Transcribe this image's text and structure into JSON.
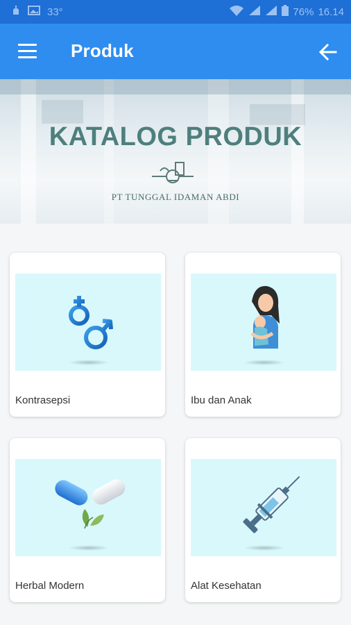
{
  "status_bar": {
    "temperature": "33°",
    "battery": "76%",
    "time": "16.14"
  },
  "app_bar": {
    "title": "Produk"
  },
  "banner": {
    "title": "KATALOG PRODUK",
    "company": "PT TUNGGAL IDAMAN ABDI"
  },
  "categories": [
    {
      "label": "Kontrasepsi",
      "icon": "gender-symbols-icon"
    },
    {
      "label": "Ibu dan Anak",
      "icon": "mother-child-icon"
    },
    {
      "label": "Herbal Modern",
      "icon": "capsule-leaf-icon"
    },
    {
      "label": "Alat Kesehatan",
      "icon": "syringe-icon"
    }
  ],
  "colors": {
    "status_bar": "#1e6fd6",
    "app_bar": "#2f8df0",
    "thumb_bg": "#d8f8fc",
    "banner_title": "#4e7f7d"
  }
}
